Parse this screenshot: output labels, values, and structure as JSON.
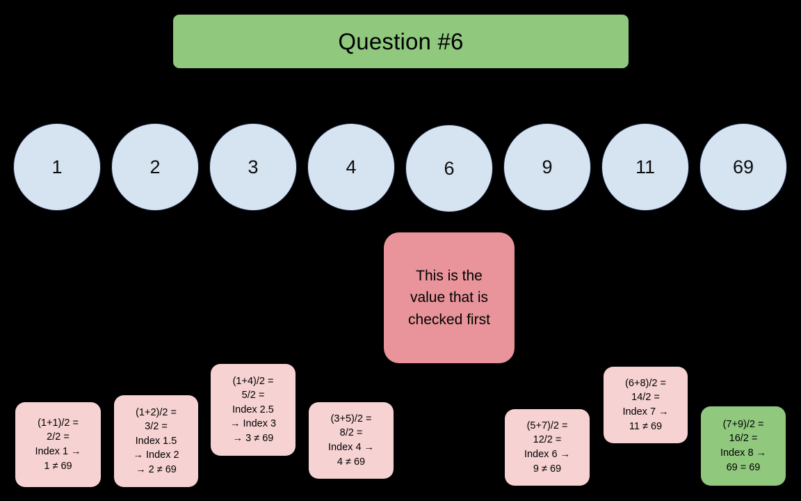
{
  "page": {
    "background_color": "#000000",
    "title": "Question #6"
  },
  "banner": {
    "label": "Question #6",
    "color": "#90c87e"
  },
  "array": {
    "circle_color": "#d6e4f2",
    "items": [
      {
        "value": "1"
      },
      {
        "value": "2"
      },
      {
        "value": "3"
      },
      {
        "value": "4"
      },
      {
        "value": "6"
      },
      {
        "value": "9"
      },
      {
        "value": "11"
      },
      {
        "value": "69"
      }
    ]
  },
  "callout": {
    "text": "This is the\nvalue that is\nchecked first",
    "color": "#e8949a"
  },
  "steps": [
    {
      "text": "(1+1)/2 =\n2/2 =\nIndex 1 →\n1 ≠  69",
      "color": "#f6d2d2"
    },
    {
      "text": "(1+2)/2 =\n3/2 =\nIndex 1.5\n→ Index 2\n→ 2 ≠  69",
      "color": "#f6d2d2"
    },
    {
      "text": "(1+4)/2 =\n5/2 =\nIndex 2.5\n→ Index 3\n→ 3 ≠  69",
      "color": "#f6d2d2"
    },
    {
      "text": "(3+5)/2 =\n8/2 =\nIndex 4 →\n4 ≠  69",
      "color": "#f6d2d2"
    },
    {
      "text": "(5+7)/2 =\n12/2 =\nIndex 6 →\n9 ≠  69",
      "color": "#f6d2d2"
    },
    {
      "text": "(6+8)/2 =\n14/2 =\nIndex 7 →\n11 ≠ 69",
      "color": "#f6d2d2"
    },
    {
      "text": "(7+9)/2 =\n16/2 =\nIndex 8 →\n69 = 69",
      "color": "#90c87e"
    }
  ]
}
